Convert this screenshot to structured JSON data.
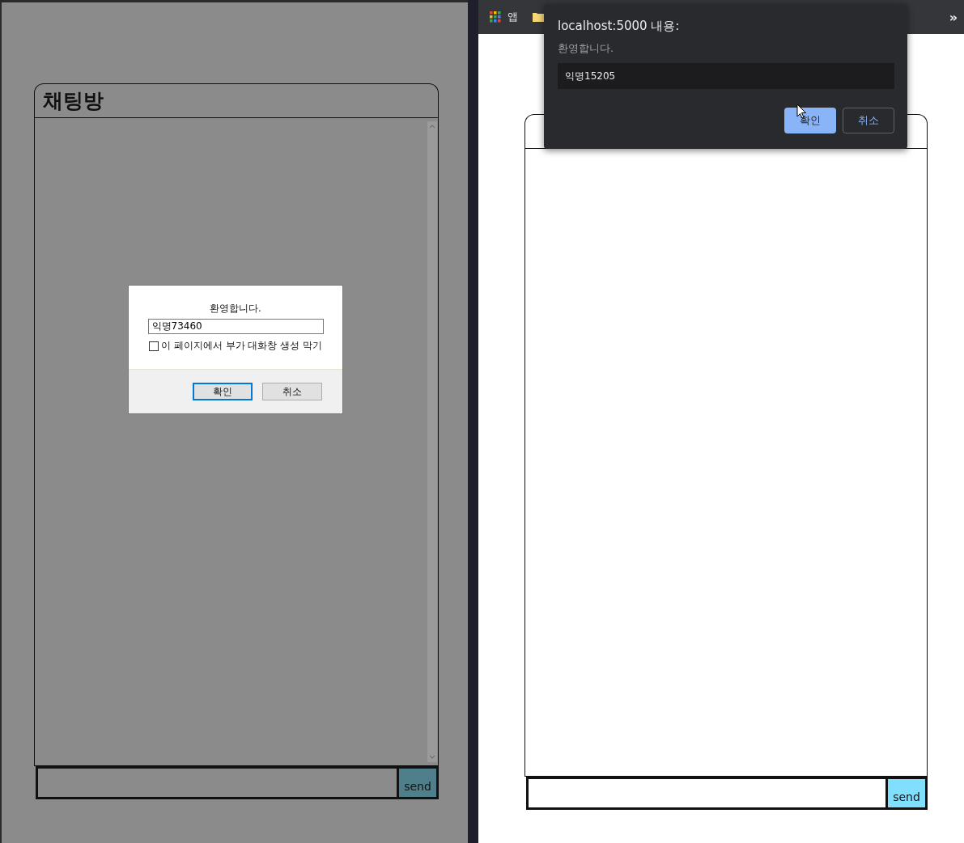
{
  "left_window": {
    "dimmed": true,
    "chat": {
      "title": "채팅방",
      "send_button": "send"
    },
    "dialog": {
      "message": "환영합니다.",
      "value": "익명73460",
      "checkbox": {
        "label": "이 페이지에서 부가 대화창 생성 막기",
        "checked": false
      },
      "buttons": [
        {
          "label": "확인",
          "selected": true
        },
        {
          "label": "취소",
          "selected": false
        }
      ]
    }
  },
  "right_window": {
    "dimmed": false,
    "bookmarks_bar": {
      "items": [
        {
          "label": "앱"
        }
      ],
      "more": "»"
    },
    "chat": {
      "send_button": "send"
    },
    "dialog": {
      "title": "localhost:5000 내용:",
      "message": "환영합니다.",
      "value": "익명15205",
      "buttons": [
        {
          "label": "확인",
          "selected": true
        },
        {
          "label": "취소",
          "selected": false
        }
      ]
    }
  }
}
